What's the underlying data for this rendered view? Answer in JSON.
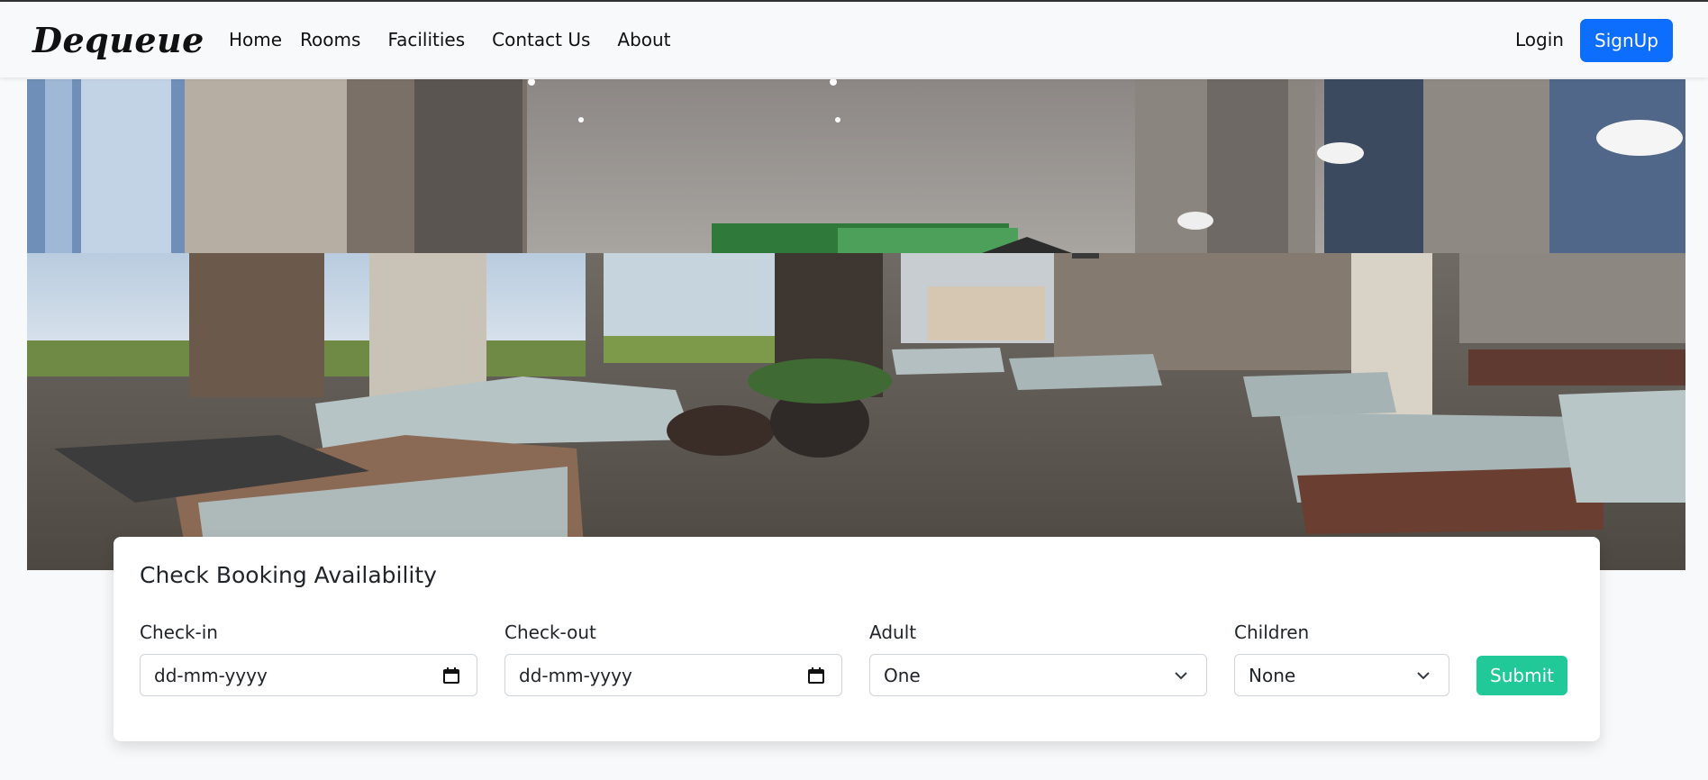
{
  "navbar": {
    "brand": "Dequeue",
    "links": [
      "Home",
      "Rooms",
      "Facilities",
      "Contact Us",
      "About"
    ],
    "login_label": "Login",
    "signup_label": "SignUp",
    "signup_color": "#0d6efd"
  },
  "booking": {
    "title": "Check Booking Availability",
    "checkin": {
      "label": "Check-in",
      "value": "dd-mm-yyyy"
    },
    "checkout": {
      "label": "Check-out",
      "value": "dd-mm-yyyy"
    },
    "adult": {
      "label": "Adult",
      "selected": "One"
    },
    "children": {
      "label": "Children",
      "selected": "None"
    },
    "submit_label": "Submit",
    "submit_color": "#20c997"
  }
}
